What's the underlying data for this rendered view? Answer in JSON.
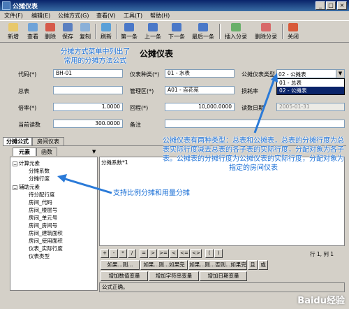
{
  "window": {
    "title": "公摊仪表"
  },
  "menubar": [
    {
      "label": "文件(F)"
    },
    {
      "label": "编辑(E)"
    },
    {
      "label": "公摊方式(G)"
    },
    {
      "label": "查看(V)"
    },
    {
      "label": "工具(T)"
    },
    {
      "label": "帮助(H)"
    }
  ],
  "toolbar": [
    {
      "label": "新增",
      "color": "#e8c86a",
      "icon": "new-doc-icon"
    },
    {
      "label": "查看",
      "color": "#6fa3d8",
      "icon": "view-icon"
    },
    {
      "label": "删除",
      "color": "#d65a4a",
      "icon": "delete-icon"
    },
    {
      "label": "保存",
      "color": "#5a7fc0",
      "icon": "save-icon"
    },
    {
      "label": "复制",
      "color": "#8ab0d8",
      "icon": "copy-icon"
    },
    {
      "label": "刷新",
      "color": "#5aa0d8",
      "icon": "refresh-icon"
    },
    {
      "label": "第一条",
      "color": "#4a78c8",
      "icon": "first-record-icon"
    },
    {
      "label": "上一条",
      "color": "#4a78c8",
      "icon": "prev-record-icon"
    },
    {
      "label": "下一条",
      "color": "#4a78c8",
      "icon": "next-record-icon"
    },
    {
      "label": "最后一条",
      "color": "#4a78c8",
      "icon": "last-record-icon"
    },
    {
      "label": "插入分录",
      "color": "#6ab06a",
      "icon": "insert-row-icon"
    },
    {
      "label": "删除分录",
      "color": "#d86a6a",
      "icon": "delete-row-icon"
    },
    {
      "label": "关闭",
      "color": "#d85a3a",
      "icon": "close-door-icon"
    }
  ],
  "form": {
    "title": "公摊仪表",
    "code_label": "代码(*)",
    "code_value": "BH-01",
    "meter_type_label": "仪表种类(*)",
    "meter_type_value": "01 - 水表",
    "meter_category_label": "公摊仪表类型",
    "meter_category_value": "02 - 公摊表",
    "meter_category_options": [
      "01 - 总表",
      "02 - 公摊表"
    ],
    "master_label": "总表",
    "master_value": "",
    "area_label": "管理区(*)",
    "area_value": "A01 - 百花苑",
    "loss_label": "损耗率",
    "loss_value": "",
    "ratio_label": "倍率(*)",
    "ratio_value": "1.0000",
    "cycle_label": "回程(*)",
    "cycle_value": "10,000.0000",
    "read_date_label": "读数日期",
    "read_date_value": "2005-01-31",
    "current_reading_label": "当前读数",
    "current_reading_value": "300.0000",
    "remark_label": "备注",
    "remark_value": ""
  },
  "tabs": {
    "formula": "分摊公式",
    "room_meter": "房间仪表",
    "elements": "元素",
    "functions": "函数"
  },
  "tree": {
    "calc_root": "计算元素",
    "calc_items": [
      "分摊系数",
      "分摊行度"
    ],
    "aux_root": "辅助元素",
    "aux_items": [
      "待分配行度",
      "房间_代码",
      "房间_楼层号",
      "房间_单元号",
      "房间_房间号",
      "房间_建筑面积",
      "房间_使用面积",
      "仪表_实际行度",
      "仪表类型"
    ]
  },
  "editor": {
    "text": "分摊系数*1",
    "cursor_pos": "行 1, 列 1"
  },
  "operators": [
    "+",
    "-",
    "*",
    "/",
    "=",
    ">",
    ">=",
    "<",
    "<=",
    "<>",
    "(",
    ")"
  ],
  "word_buttons": [
    "如果...则...",
    "如果...则...如果完",
    "如果...则...否则...如果完",
    "且",
    "或"
  ],
  "add_buttons": [
    "增加数值变量",
    "增加字符串变量",
    "增加日期变量"
  ],
  "status": "公式正确。",
  "annotations": {
    "menu_note": "分摊方式菜单中列出了\n常用的分摊方法公式",
    "type_note": "公摊仪表有两种类型：总表和公摊表，总表的分摊行度为总表实际行度减去总表的各子表的实际行度，分配对象为各子表。公摊表的分摊行度为公摊仪表的实际行度，分配对象为指定的房间仪表",
    "tree_note": "支持比例分摊和用量分摊"
  },
  "watermark": "Baidu经验"
}
